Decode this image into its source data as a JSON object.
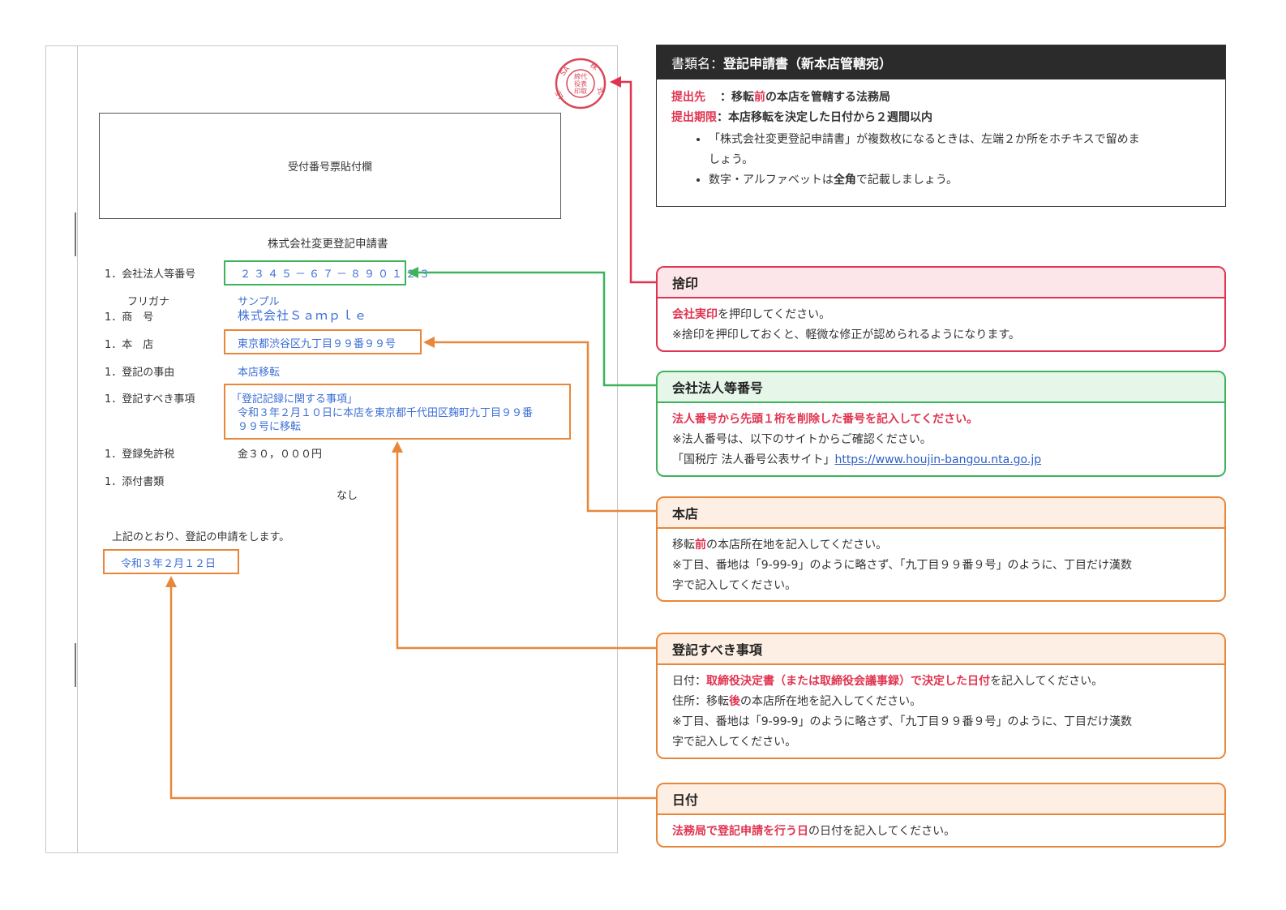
{
  "document": {
    "receipt_label": "受付番号票貼付欄",
    "title": "株式会社変更登記申請書",
    "items": {
      "corp_number_label": "1．会社法人等番号",
      "corp_number_value": "２３４５－６７－８９０１２３",
      "furigana_label": "フリガナ",
      "furigana_value": "サンプル",
      "trade_name_label": "1．商　号",
      "trade_name_value": "株式会社Ｓａｍｐｌｅ",
      "head_office_label": "1．本　店",
      "head_office_value": "東京都渋谷区九丁目９９番９９号",
      "reason_label": "1．登記の事由",
      "reason_value": "本店移転",
      "matters_label": "1．登記すべき事項",
      "matters_line1": "「登記記録に関する事項」",
      "matters_line2": "令和３年２月１０日に本店を東京都千代田区麹町九丁目９９番",
      "matters_line3": "９９号に移転",
      "tax_label": "1．登録免許税",
      "tax_value": "金３０，０００円",
      "attachments_label": "1．添付書類",
      "attachments_value": "なし"
    },
    "closing": "上記のとおり、登記の申請をします。",
    "date": "令和３年２月１２日",
    "seal_text": "SAMPLE 株式会社 代表取締役印"
  },
  "cards": {
    "doc": {
      "title_prefix": "書類名：",
      "title_main": "登記申請書（新本店管轄宛）",
      "submit_to_label": "提出先",
      "submit_to_pre": "：移転",
      "submit_to_em": "前",
      "submit_to_post": "の本店を管轄する法務局",
      "deadline_label": "提出期限",
      "deadline_text": "：本店移転を決定した日付から２週間以内",
      "bullet1_line1": "「株式会社変更登記申請書」が複数枚になるときは、左端２か所をホチキスで留めま",
      "bullet1_line2": "しょう。",
      "bullet2_pre": "数字・アルファベットは",
      "bullet2_em": "全角",
      "bullet2_post": "で記載しましょう。"
    },
    "seal": {
      "title": "捨印",
      "line1_em": "会社実印",
      "line1_post": "を押印してください。",
      "line2": "※捨印を押印しておくと、軽微な修正が認められるようになります。"
    },
    "corp": {
      "title": "会社法人等番号",
      "line1": "法人番号から先頭１桁を削除した番号を記入してください。",
      "line2": "※法人番号は、以下のサイトからご確認ください。",
      "line3_pre": "「国税庁 法人番号公表サイト」",
      "line3_link": "https://www.houjin-bangou.nta.go.jp"
    },
    "honten": {
      "title": "本店",
      "line1_pre": "移転",
      "line1_em": "前",
      "line1_post": "の本店所在地を記入してください。",
      "line2": "※丁目、番地は「9-99-9」のように略さず、「九丁目９９番９号」のように、丁目だけ漢数",
      "line3": "字で記入してください。"
    },
    "touki": {
      "title": "登記すべき事項",
      "line1_pre": "日付：",
      "line1_em": "取締役決定書（または取締役会議事録）で決定した日付",
      "line1_post": "を記入してください。",
      "line2_pre": "住所：移転",
      "line2_em": "後",
      "line2_post": "の本店所在地を記入してください。",
      "line3": "※丁目、番地は「9-99-9」のように略さず、「九丁目９９番９号」のように、丁目だけ漢数",
      "line4": "字で記入してください。"
    },
    "date": {
      "title": "日付",
      "line1_em": "法務局で登記申請を行う日",
      "line1_post": "の日付を記入してください。"
    }
  },
  "colors": {
    "red": "#e0334f",
    "green": "#3db35c",
    "orange": "#e8873a",
    "blue_text": "#3d6fd6",
    "dark_header": "#2b2b2b"
  }
}
